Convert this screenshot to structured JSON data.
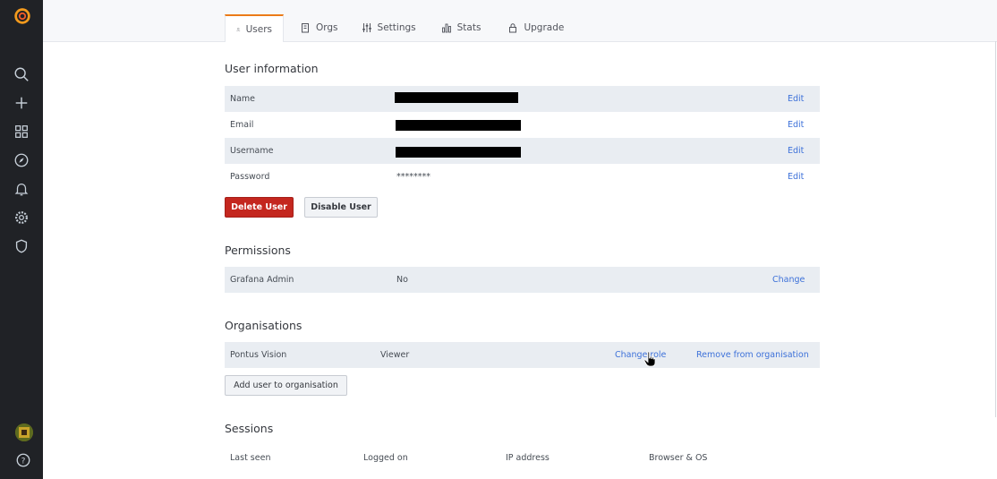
{
  "sidebar": {
    "icons": [
      "grafana-logo",
      "search-icon",
      "plus-icon",
      "dashboards-icon",
      "compass-icon",
      "bell-icon",
      "gear-icon",
      "shield-icon",
      "avatar",
      "help-icon"
    ]
  },
  "tabs": [
    {
      "label": "Users",
      "icon": "user-icon",
      "active": true
    },
    {
      "label": "Orgs",
      "icon": "building-icon",
      "active": false
    },
    {
      "label": "Settings",
      "icon": "sliders-icon",
      "active": false
    },
    {
      "label": "Stats",
      "icon": "bar-chart-icon",
      "active": false
    },
    {
      "label": "Upgrade",
      "icon": "lock-icon",
      "active": false
    }
  ],
  "user_information": {
    "title": "User information",
    "rows": [
      {
        "label": "Name",
        "value": "",
        "action": "Edit"
      },
      {
        "label": "Email",
        "value": "",
        "action": "Edit"
      },
      {
        "label": "Username",
        "value": "",
        "action": "Edit"
      },
      {
        "label": "Password",
        "value": "********",
        "action": "Edit"
      }
    ],
    "delete_label": "Delete User",
    "disable_label": "Disable User"
  },
  "permissions": {
    "title": "Permissions",
    "rows": [
      {
        "label": "Grafana Admin",
        "value": "No",
        "action": "Change"
      }
    ]
  },
  "organisations": {
    "title": "Organisations",
    "rows": [
      {
        "name": "Pontus Vision",
        "role": "Viewer",
        "change_role": "Change role",
        "remove": "Remove from organisation"
      }
    ],
    "add_label": "Add user to organisation"
  },
  "sessions": {
    "title": "Sessions",
    "columns": [
      "Last seen",
      "Logged on",
      "IP address",
      "Browser & OS"
    ]
  },
  "colors": {
    "sidebar_bg": "#202226",
    "accent": "#eb7b18",
    "link": "#3d71d9",
    "danger": "#c4271f",
    "row_shade": "#e9edf2"
  }
}
